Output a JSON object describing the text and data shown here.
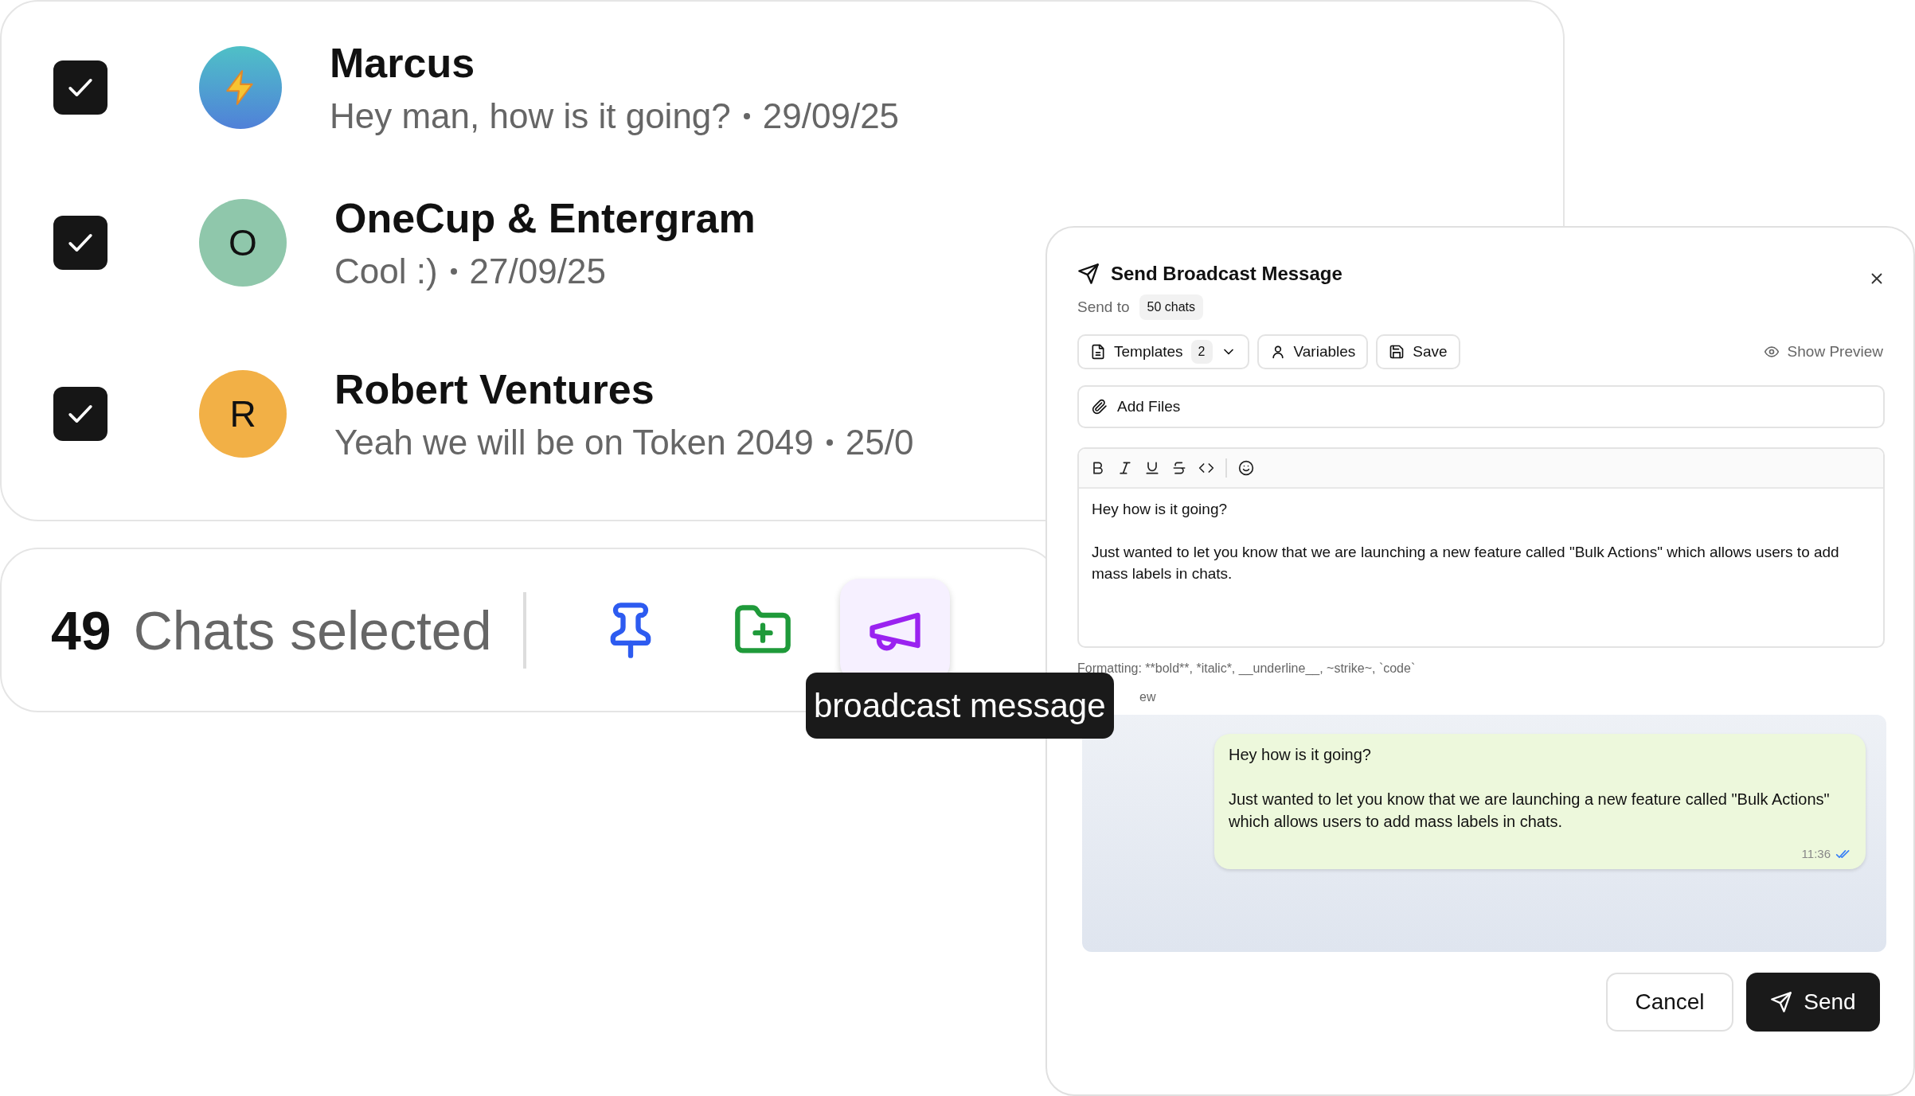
{
  "chat_list": {
    "rows": [
      {
        "name": "Marcus",
        "preview": "Hey man, how is it going?",
        "date": "29/09/25",
        "checked": true,
        "avatar": {
          "kind": "bolt"
        }
      },
      {
        "name": "OneCup & Entergram",
        "preview": "Cool :)",
        "date": "27/09/25",
        "checked": true,
        "avatar": {
          "kind": "letter",
          "initial": "O",
          "color": "#8fc7ab"
        }
      },
      {
        "name": "Robert Ventures",
        "preview": "Yeah we will be on Token 2049",
        "date": "25/0",
        "checked": true,
        "avatar": {
          "kind": "letter",
          "initial": "R",
          "color": "#f2b046"
        }
      }
    ]
  },
  "selection_bar": {
    "count": "49",
    "label": "Chats selected",
    "actions": [
      {
        "kind": "pin",
        "selected": false
      },
      {
        "kind": "folder_add",
        "selected": false
      },
      {
        "kind": "broadcast",
        "selected": true
      }
    ],
    "tooltip": "broadcast message"
  },
  "dialog": {
    "title": "Send Broadcast Message",
    "send_to_label": "Send to",
    "recipients": "50 chats",
    "toolbar": {
      "templates": {
        "label": "Templates",
        "count": "2"
      },
      "variables": "Variables",
      "save": "Save",
      "show_preview": "Show Preview"
    },
    "add_files": "Add Files",
    "format_buttons": [
      {
        "kind": "bold"
      },
      {
        "kind": "italic"
      },
      {
        "kind": "underline"
      },
      {
        "kind": "strike"
      },
      {
        "kind": "code"
      },
      {
        "kind": "emoji"
      }
    ],
    "message": "Hey how is it going?\n\nJust wanted to let you know that we are launching a new feature called \"Bulk Actions\" which allows users to add mass labels in chats.",
    "formatting_hint": "Formatting: **bold**, *italic*, __underline__, ~strike~, `code`",
    "preview_label": "ew",
    "preview": {
      "text": "Hey how is it going?\n\nJust wanted to let you know that we are launching a new feature called \"Bulk Actions\" which allows users to add mass labels in chats.",
      "time": "11:36",
      "read": true
    },
    "buttons": {
      "cancel": "Cancel",
      "send": "Send"
    }
  }
}
